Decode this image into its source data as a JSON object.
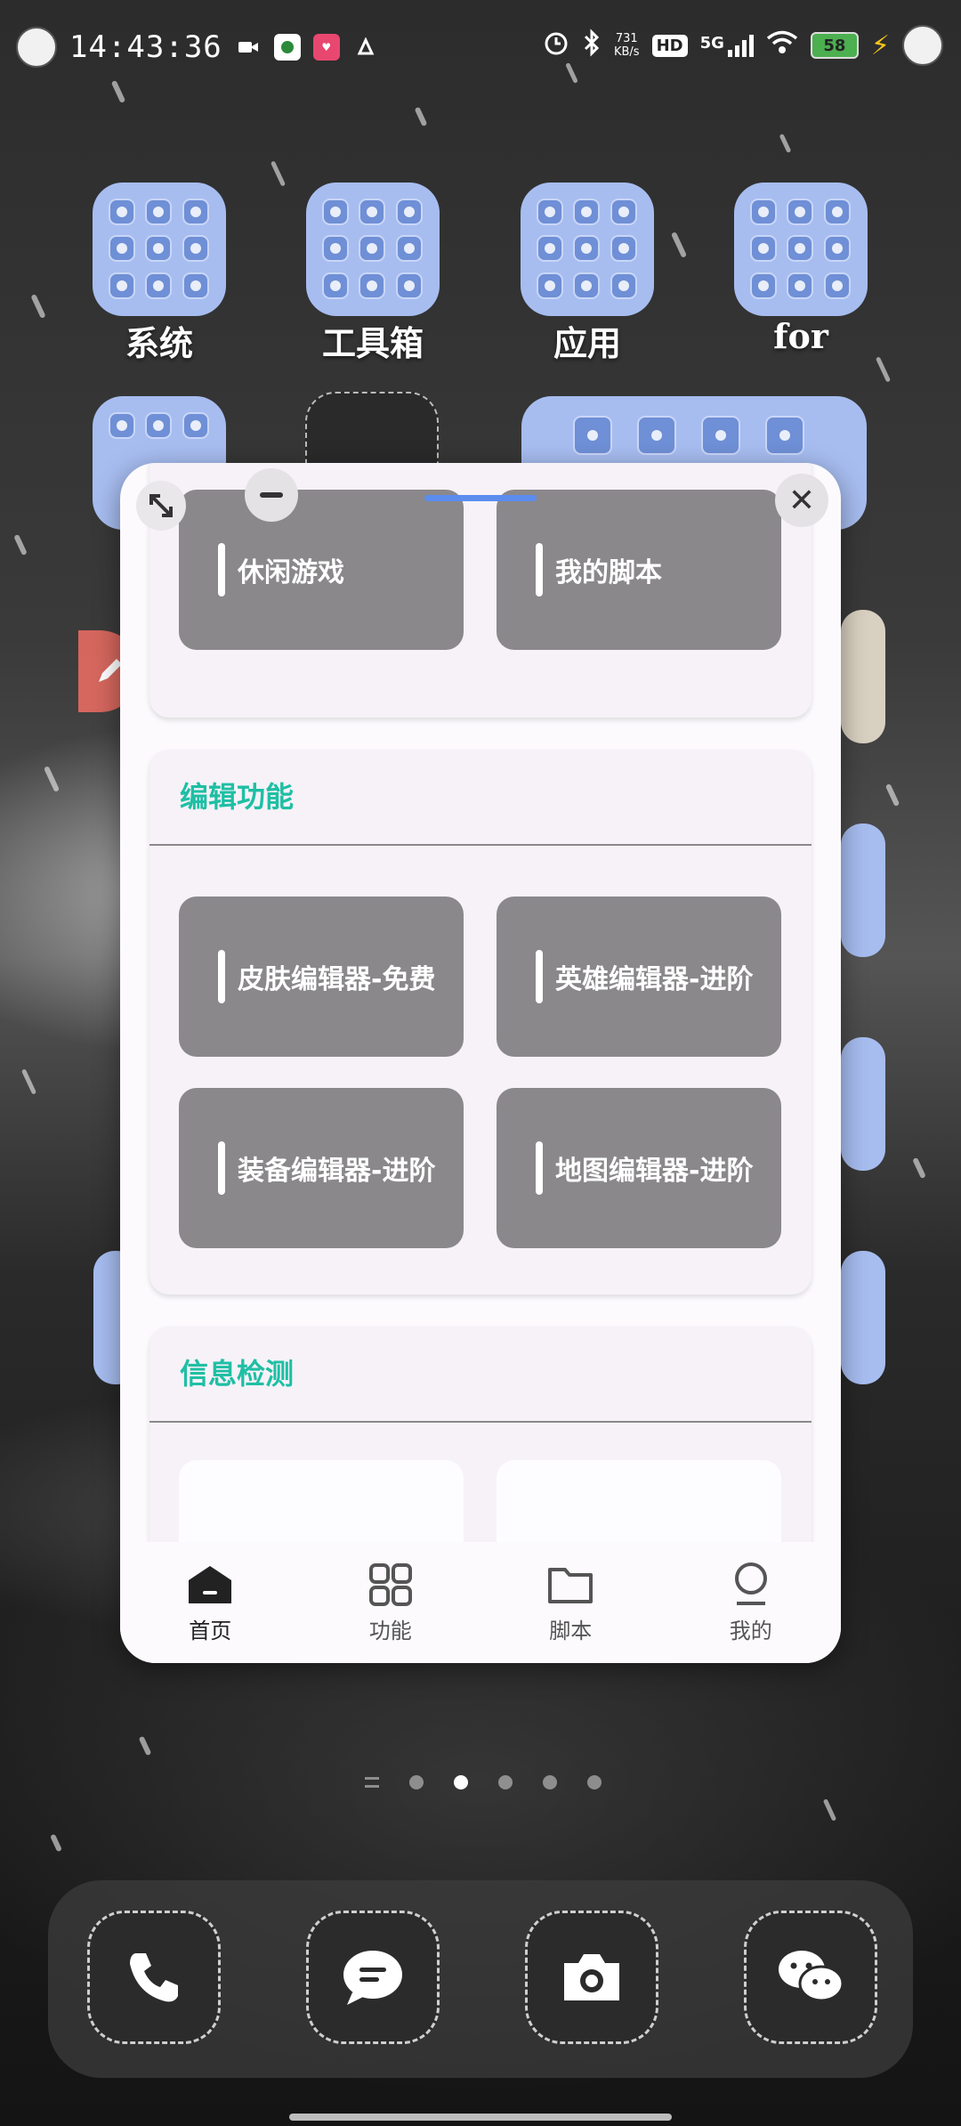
{
  "status_bar": {
    "time": "14:43:36",
    "net_speed_value": "731",
    "net_speed_unit": "KB/s",
    "hd_label": "HD",
    "network_label": "5G",
    "battery": "58"
  },
  "home": {
    "folders": [
      {
        "label": "系统"
      },
      {
        "label": "工具箱"
      },
      {
        "label": "应用"
      },
      {
        "label": "for"
      }
    ]
  },
  "window": {
    "top_tiles": [
      {
        "label": "休闲游戏"
      },
      {
        "label": "我的脚本"
      }
    ],
    "edit_section": {
      "title": "编辑功能",
      "tiles": [
        {
          "label": "皮肤编辑器-免费"
        },
        {
          "label": "英雄编辑器-进阶"
        },
        {
          "label": "装备编辑器-进阶"
        },
        {
          "label": "地图编辑器-进阶"
        }
      ]
    },
    "info_section": {
      "title": "信息检测"
    },
    "close_glyph": "✕"
  },
  "bottom_nav": {
    "items": [
      {
        "label": "首页",
        "icon": "home-icon",
        "active": true
      },
      {
        "label": "功能",
        "icon": "grid-icon",
        "active": false
      },
      {
        "label": "脚本",
        "icon": "folder-icon",
        "active": false
      },
      {
        "label": "我的",
        "icon": "user-icon",
        "active": false
      }
    ]
  },
  "pager": {
    "pages": 5,
    "current": 2
  },
  "dock": {
    "apps": [
      {
        "icon": "phone-icon"
      },
      {
        "icon": "message-icon"
      },
      {
        "icon": "camera-icon"
      },
      {
        "icon": "wechat-icon"
      }
    ]
  },
  "colors": {
    "accent": "#1fbfa4",
    "tile": "#8a888b",
    "folder": "#a7bdf0",
    "handle": "#5b8def"
  }
}
